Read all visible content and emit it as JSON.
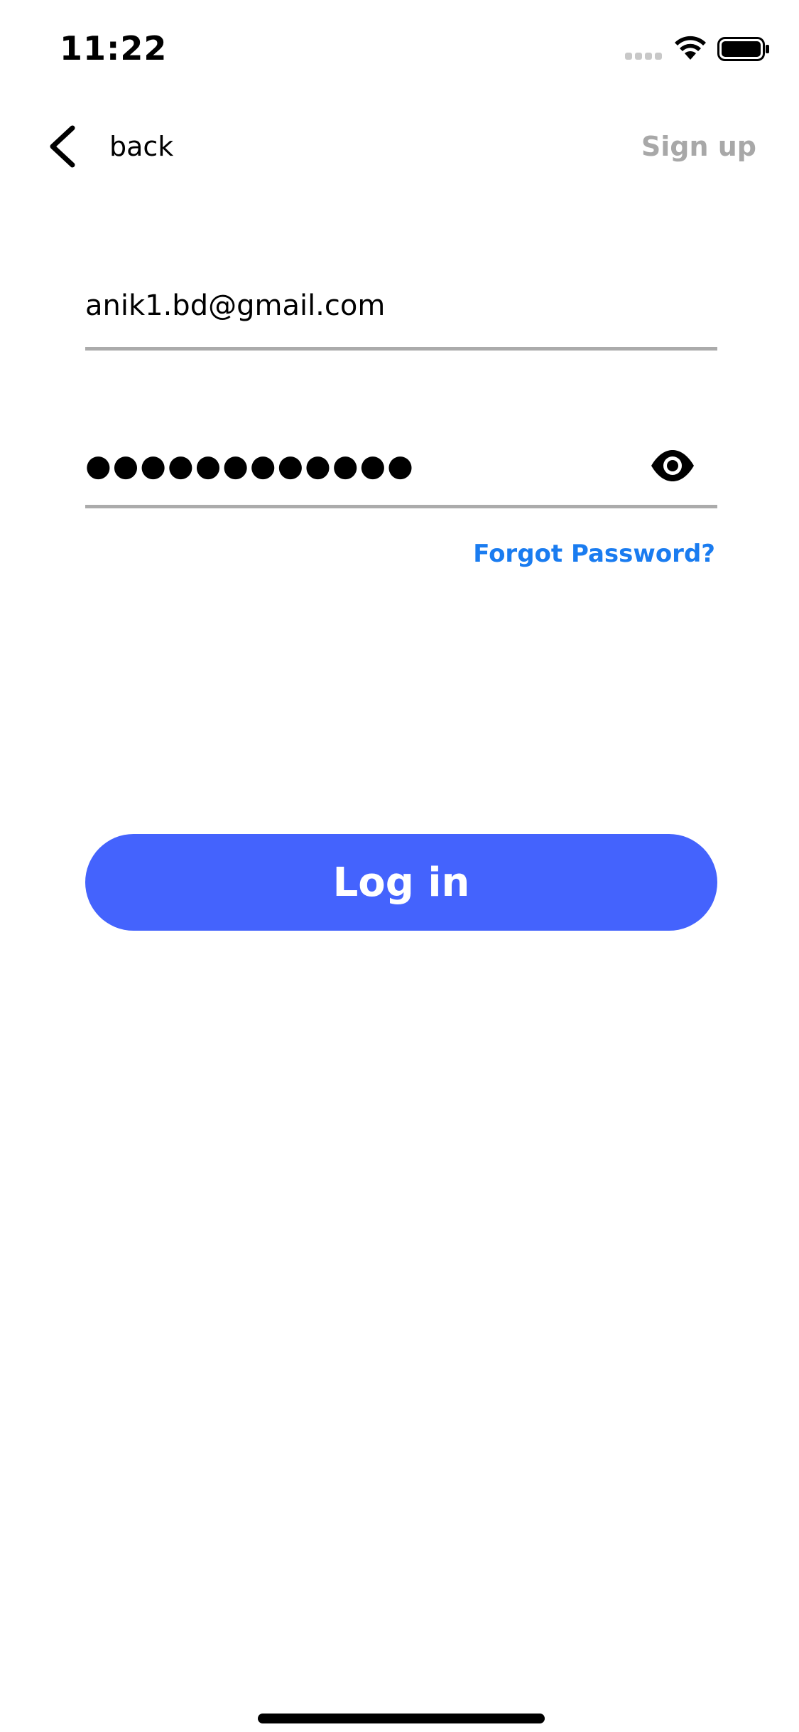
{
  "status_bar": {
    "time": "11:22",
    "icons": [
      "cellular-signal-icon",
      "wifi-icon",
      "battery-icon"
    ]
  },
  "nav": {
    "back_label": "back",
    "back_icon": "chevron-left-icon",
    "sign_up_label": "Sign up"
  },
  "form": {
    "email_value": "anik1.bd@gmail.com",
    "password_masked": "●●●●●●●●●●●●",
    "password_toggle_icon": "eye-icon",
    "forgot_password_label": "Forgot Password?",
    "login_label": "Log in"
  },
  "colors": {
    "accent_button": "#4463fd",
    "link": "#1a7cf0",
    "muted_text": "#a8a8a8",
    "underline": "#ababab"
  }
}
